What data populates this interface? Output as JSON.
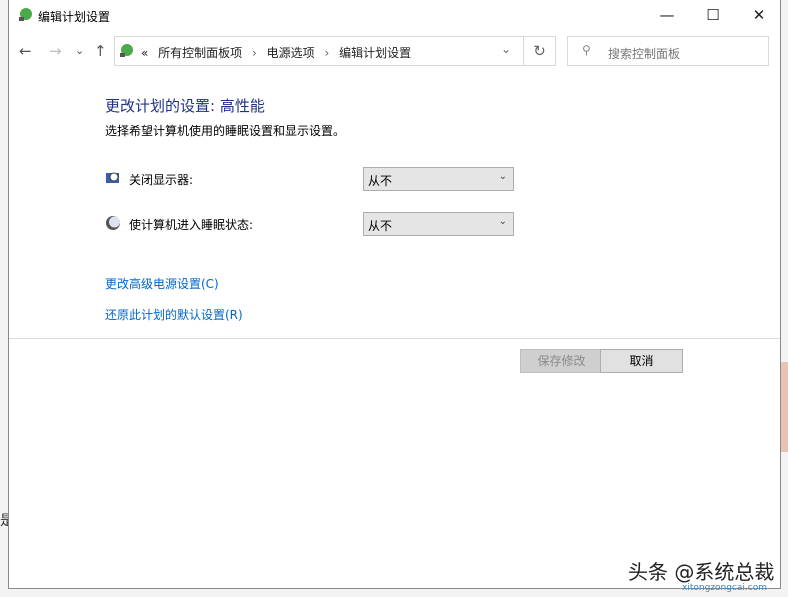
{
  "window": {
    "title": "编辑计划设置",
    "minimize": "—",
    "maximize": "☐",
    "close": "✕"
  },
  "nav": {
    "back": "←",
    "forward": "→",
    "recent": "⌄",
    "up": "↑",
    "overflow": "«",
    "crumbs": [
      "所有控制面板项",
      "电源选项",
      "编辑计划设置"
    ],
    "separator": "›",
    "dropdown": "⌄",
    "refresh": "↻"
  },
  "search": {
    "placeholder": "搜索控制面板"
  },
  "main": {
    "heading": "更改计划的设置: 高性能",
    "description": "选择希望计算机使用的睡眠设置和显示设置。",
    "settings": [
      {
        "label": "关闭显示器:",
        "value": "从不"
      },
      {
        "label": "使计算机进入睡眠状态:",
        "value": "从不"
      }
    ],
    "links": [
      "更改高级电源设置(C)",
      "还原此计划的默认设置(R)"
    ],
    "save": "保存修改",
    "cancel": "取消"
  },
  "watermark": {
    "text": "头条 @系统总裁",
    "site": "xitongzongcai.com"
  },
  "background_fragment": "是"
}
